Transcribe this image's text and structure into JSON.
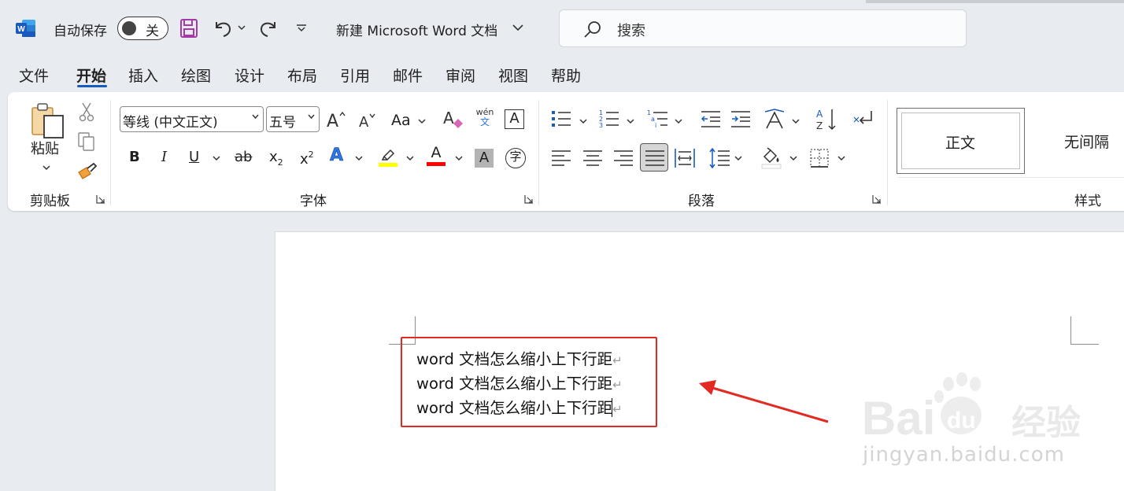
{
  "titlebar": {
    "autosave_label": "自动保存",
    "autosave_state": "关",
    "document_title": "新建 Microsoft Word 文档",
    "search_placeholder": "搜索"
  },
  "tabs": [
    "文件",
    "开始",
    "插入",
    "绘图",
    "设计",
    "布局",
    "引用",
    "邮件",
    "审阅",
    "视图",
    "帮助"
  ],
  "active_tab": "开始",
  "ribbon": {
    "clipboard": {
      "paste_label": "粘贴",
      "group_label": "剪贴板"
    },
    "font": {
      "font_name": "等线 (中文正文)",
      "font_size": "五号",
      "case_label": "Aa",
      "phonetic_top": "wén",
      "phonetic_bottom": "文",
      "border_char": "A",
      "bold": "B",
      "italic": "I",
      "underline": "U",
      "strike": "ab",
      "subscript": "x",
      "subscript_mark": "2",
      "superscript": "x",
      "superscript_mark": "2",
      "effects": "A",
      "font_color": "A",
      "shading_char": "A",
      "enclose_char": "字",
      "group_label": "字体",
      "colors": {
        "highlight": "#ffff00",
        "font_color": "#ff0000",
        "effects": "#2b78e4"
      }
    },
    "paragraph": {
      "group_label": "段落"
    },
    "styles": {
      "normal": "正文",
      "no_spacing": "无间隔",
      "group_label": "样式"
    }
  },
  "document": {
    "lines": [
      "word 文档怎么缩小上下行距",
      "word 文档怎么缩小上下行距",
      "word 文档怎么缩小上下行距"
    ],
    "paragraph_mark": "↵"
  },
  "watermark": {
    "brand": "Bai",
    "brand2": "du",
    "brand_cn": "经验",
    "url": "jingyan.baidu.com"
  },
  "accent_colors": {
    "word_blue": "#185abd",
    "annotation_red": "#e32a22"
  }
}
